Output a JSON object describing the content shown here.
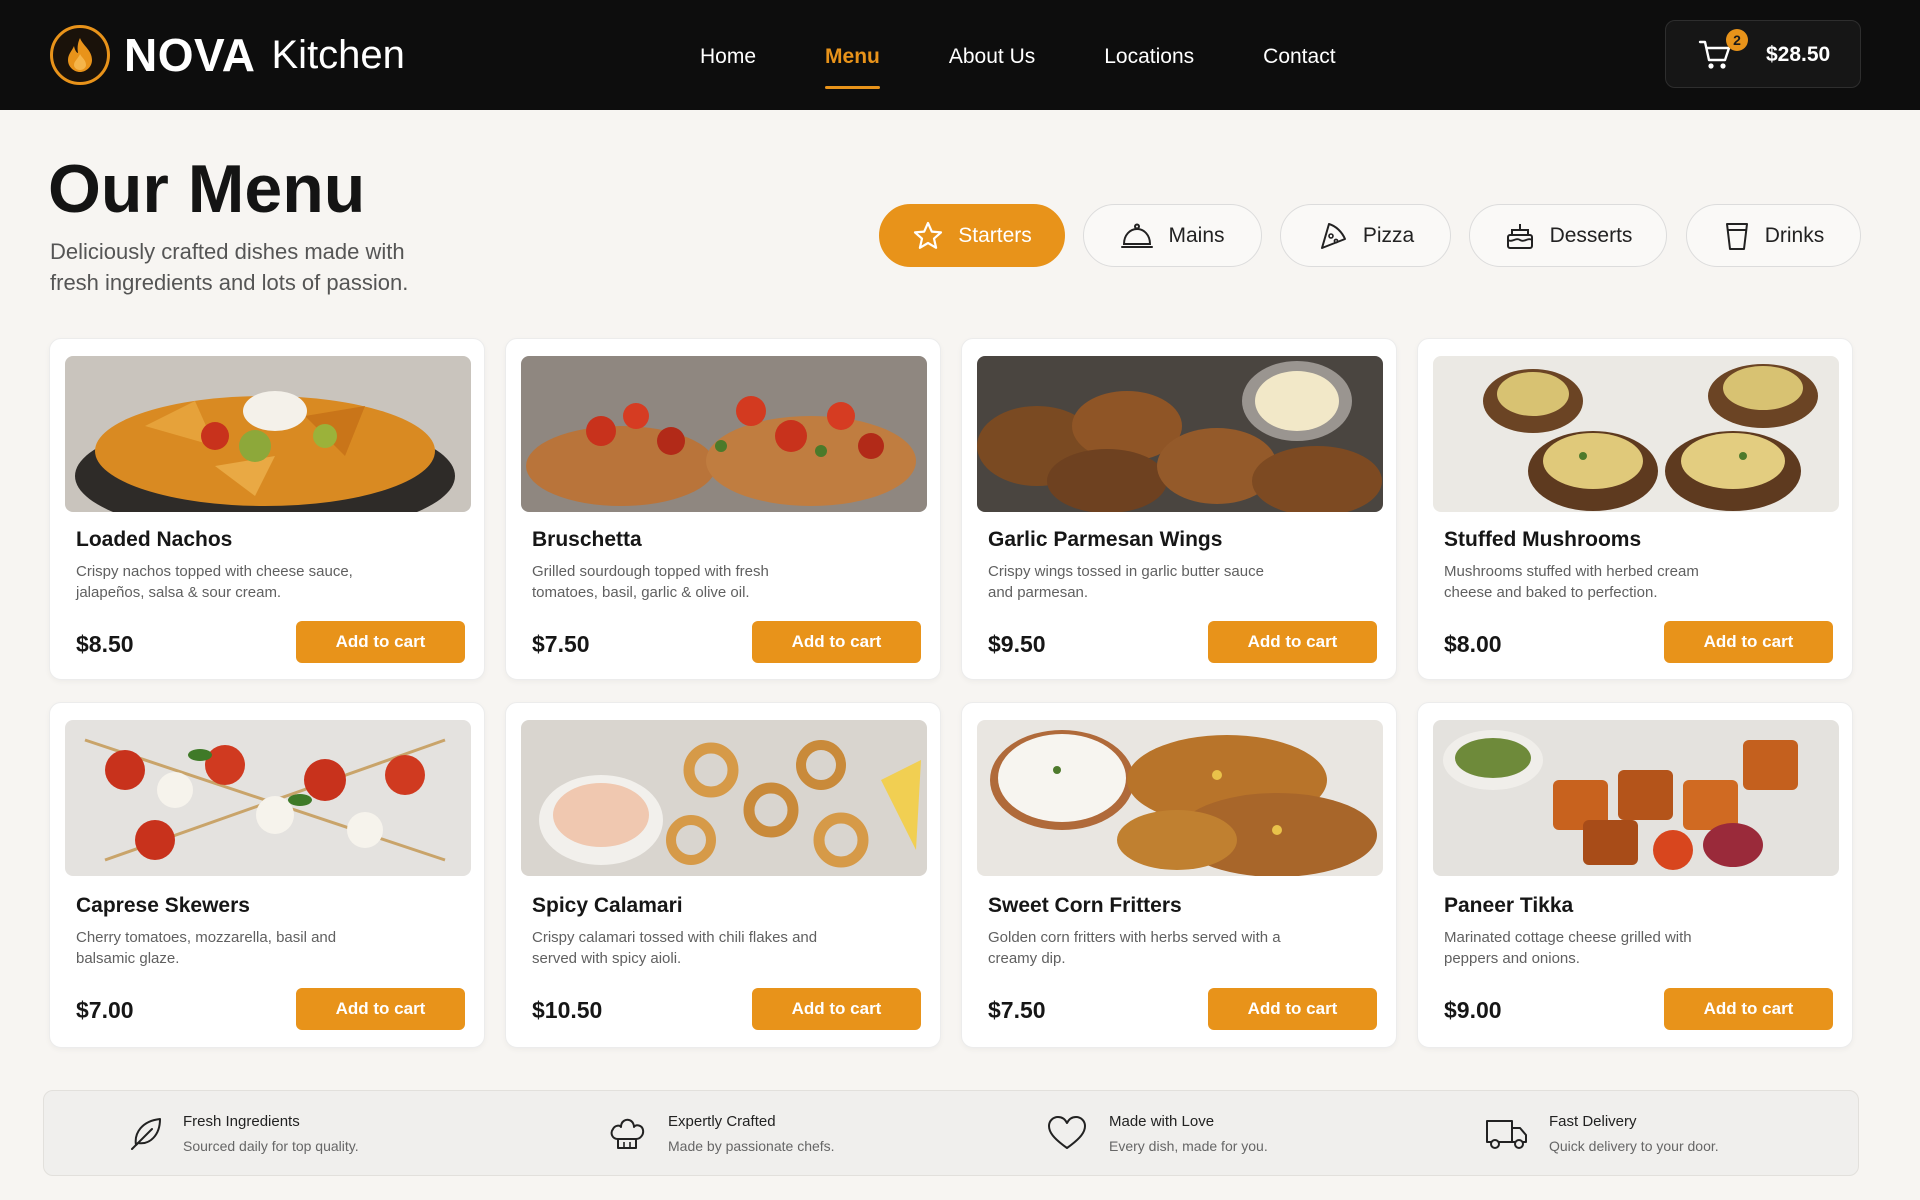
{
  "header": {
    "brand": "NOVA",
    "brand_sub": "Kitchen",
    "nav": [
      {
        "label": "Home",
        "active": false
      },
      {
        "label": "Menu",
        "active": true
      },
      {
        "label": "About Us",
        "active": false
      },
      {
        "label": "Locations",
        "active": false
      },
      {
        "label": "Contact",
        "active": false
      }
    ],
    "cart": {
      "count": "2",
      "total": "$28.50",
      "icon": "cart-icon"
    }
  },
  "intro": {
    "title": "Our Menu",
    "subtitle": "Deliciously crafted dishes made with fresh ingredients and lots of passion."
  },
  "tabs": [
    {
      "label": "Starters",
      "icon": "star-icon",
      "active": true
    },
    {
      "label": "Mains",
      "icon": "cloche-icon",
      "active": false
    },
    {
      "label": "Pizza",
      "icon": "pizza-icon",
      "active": false
    },
    {
      "label": "Desserts",
      "icon": "cake-icon",
      "active": false
    },
    {
      "label": "Drinks",
      "icon": "cup-icon",
      "active": false
    }
  ],
  "menu_items": [
    {
      "name": "Loaded Nachos",
      "description": "Crispy nachos topped with cheese sauce, jalapeños, salsa & sour cream.",
      "price": "$8.50",
      "button": "Add to cart"
    },
    {
      "name": "Bruschetta",
      "description": "Grilled sourdough topped with fresh tomatoes, basil, garlic & olive oil.",
      "price": "$7.50",
      "button": "Add to cart"
    },
    {
      "name": "Garlic Parmesan Wings",
      "description": "Crispy wings tossed in garlic butter sauce and parmesan.",
      "price": "$9.50",
      "button": "Add to cart"
    },
    {
      "name": "Stuffed Mushrooms",
      "description": "Mushrooms stuffed with herbed cream cheese and baked to perfection.",
      "price": "$8.00",
      "button": "Add to cart"
    },
    {
      "name": "Caprese Skewers",
      "description": "Cherry tomatoes, mozzarella, basil and balsamic glaze.",
      "price": "$7.00",
      "button": "Add to cart"
    },
    {
      "name": "Spicy Calamari",
      "description": "Crispy calamari tossed with chili flakes and served with spicy aioli.",
      "price": "$10.50",
      "button": "Add to cart"
    },
    {
      "name": "Sweet Corn Fritters",
      "description": "Golden corn fritters with herbs served with a creamy dip.",
      "price": "$7.50",
      "button": "Add to cart"
    },
    {
      "name": "Paneer Tikka",
      "description": "Marinated cottage cheese grilled with peppers and onions.",
      "price": "$9.00",
      "button": "Add to cart"
    }
  ],
  "features": [
    {
      "title": "Fresh Ingredients",
      "description": "Sourced daily for top quality.",
      "icon": "leaf-icon"
    },
    {
      "title": "Expertly Crafted",
      "description": "Made by passionate chefs.",
      "icon": "chef-hat-icon"
    },
    {
      "title": "Made with Love",
      "description": "Every dish, made for you.",
      "icon": "heart-icon"
    },
    {
      "title": "Fast Delivery",
      "description": "Quick delivery to your door.",
      "icon": "truck-icon"
    }
  ],
  "colors": {
    "accent": "#e8931a",
    "header_bg": "#0d0d0d",
    "page_bg": "#f7f5f2"
  }
}
